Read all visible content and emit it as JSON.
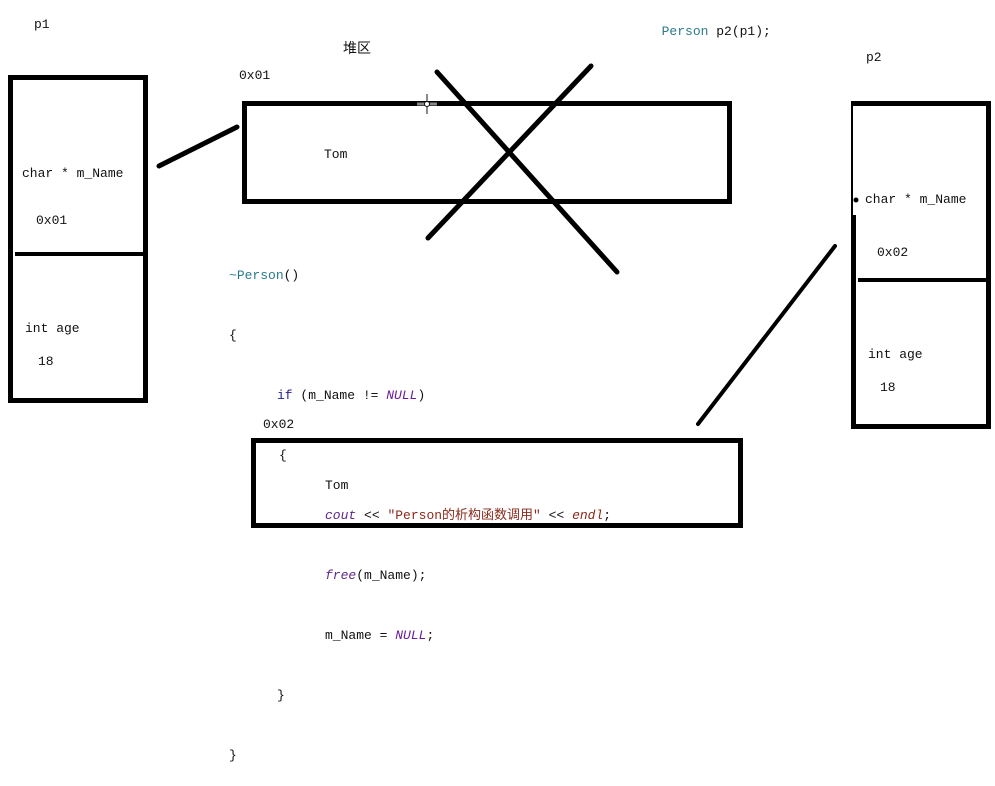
{
  "header": {
    "copy_statement": {
      "type": "Person",
      "rest": " p2(p1);"
    }
  },
  "heap_label": "堆区",
  "objects": {
    "p1": {
      "name": "p1",
      "field1_label": "char * m_Name",
      "field1_value": "0x01",
      "field2_label": "int age",
      "field2_value": "18"
    },
    "p2": {
      "name": "p2",
      "field1_label": "char * m_Name",
      "field1_value": "0x02",
      "field2_label": "int age",
      "field2_value": "18"
    }
  },
  "heap_blocks": [
    {
      "address": "0x01",
      "value": "Tom",
      "freed": true
    },
    {
      "address": "0x02",
      "value": "Tom",
      "freed": false
    }
  ],
  "destructor_code": {
    "tilde": "~",
    "name": "Person",
    "parens": "()",
    "open_brace": "{",
    "if_kw": "if",
    "if_cond_start": " (m_Name != ",
    "null1": "NULL",
    "if_cond_end": ")",
    "inner_open": "{",
    "cout": "cout",
    "shift1": " << ",
    "message": "\"Person的析构函数调用\"",
    "shift2": " << ",
    "endl": "endl",
    "semi1": ";",
    "free_fn": "free",
    "free_args": "(m_Name);",
    "assign": "m_Name = ",
    "null2": "NULL",
    "semi2": ";",
    "inner_close": "}",
    "close_brace": "}"
  },
  "colors": {
    "type": "#2b7a8a",
    "keyword": "#1f1f9a",
    "macro": "#6a1a9a",
    "string": "#8a2a1a",
    "line": "#000000"
  }
}
